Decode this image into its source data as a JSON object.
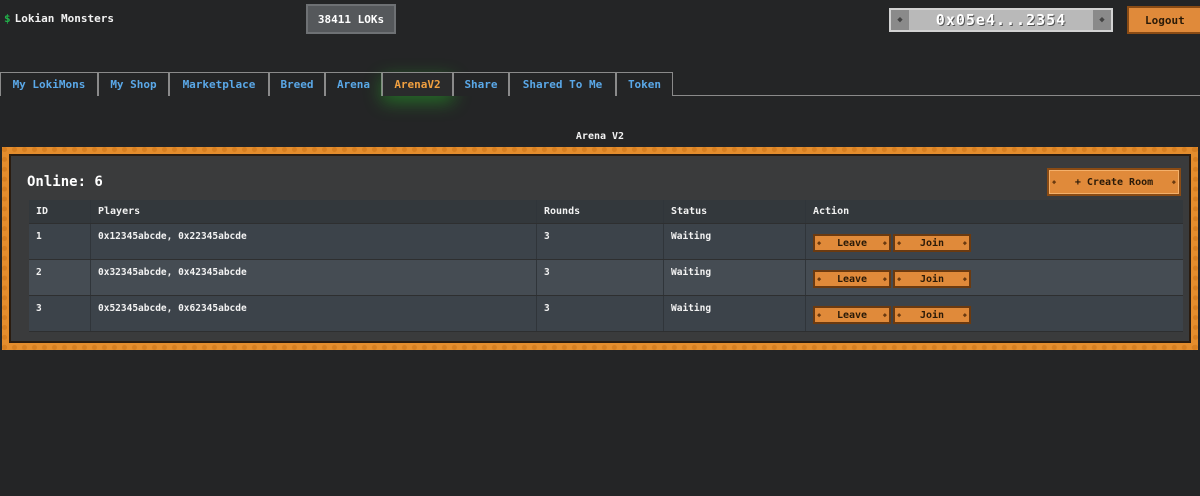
{
  "header": {
    "logo_symbol": "$",
    "app_title": "Lokian Monsters",
    "balance": "38411 LOKs",
    "wallet_address": "0x05e4...2354",
    "logout_label": "Logout"
  },
  "tabs": [
    {
      "label": "My LokiMons",
      "active": false
    },
    {
      "label": "My Shop",
      "active": false
    },
    {
      "label": "Marketplace",
      "active": false
    },
    {
      "label": "Breed",
      "active": false
    },
    {
      "label": "Arena",
      "active": false
    },
    {
      "label": "ArenaV2",
      "active": true
    },
    {
      "label": "Share",
      "active": false
    },
    {
      "label": "Shared To Me",
      "active": false
    },
    {
      "label": "Token",
      "active": false
    }
  ],
  "section_title": "Arena V2",
  "arena": {
    "online_label": "Online: 6",
    "create_room_label": "+ Create Room",
    "columns": [
      "ID",
      "Players",
      "Rounds",
      "Status",
      "Action"
    ],
    "rooms": [
      {
        "id": "1",
        "players": "0x12345abcde, 0x22345abcde",
        "rounds": "3",
        "status": "Waiting",
        "leave": "Leave",
        "join": "Join"
      },
      {
        "id": "2",
        "players": "0x32345abcde, 0x42345abcde",
        "rounds": "3",
        "status": "Waiting",
        "leave": "Leave",
        "join": "Join"
      },
      {
        "id": "3",
        "players": "0x52345abcde, 0x62345abcde",
        "rounds": "3",
        "status": "Waiting",
        "leave": "Leave",
        "join": "Join"
      }
    ]
  },
  "colors": {
    "accent_orange": "#e08a3a",
    "tab_link": "#5aa8e8",
    "tab_active": "#f0a040",
    "logo_green": "#21b14a"
  }
}
